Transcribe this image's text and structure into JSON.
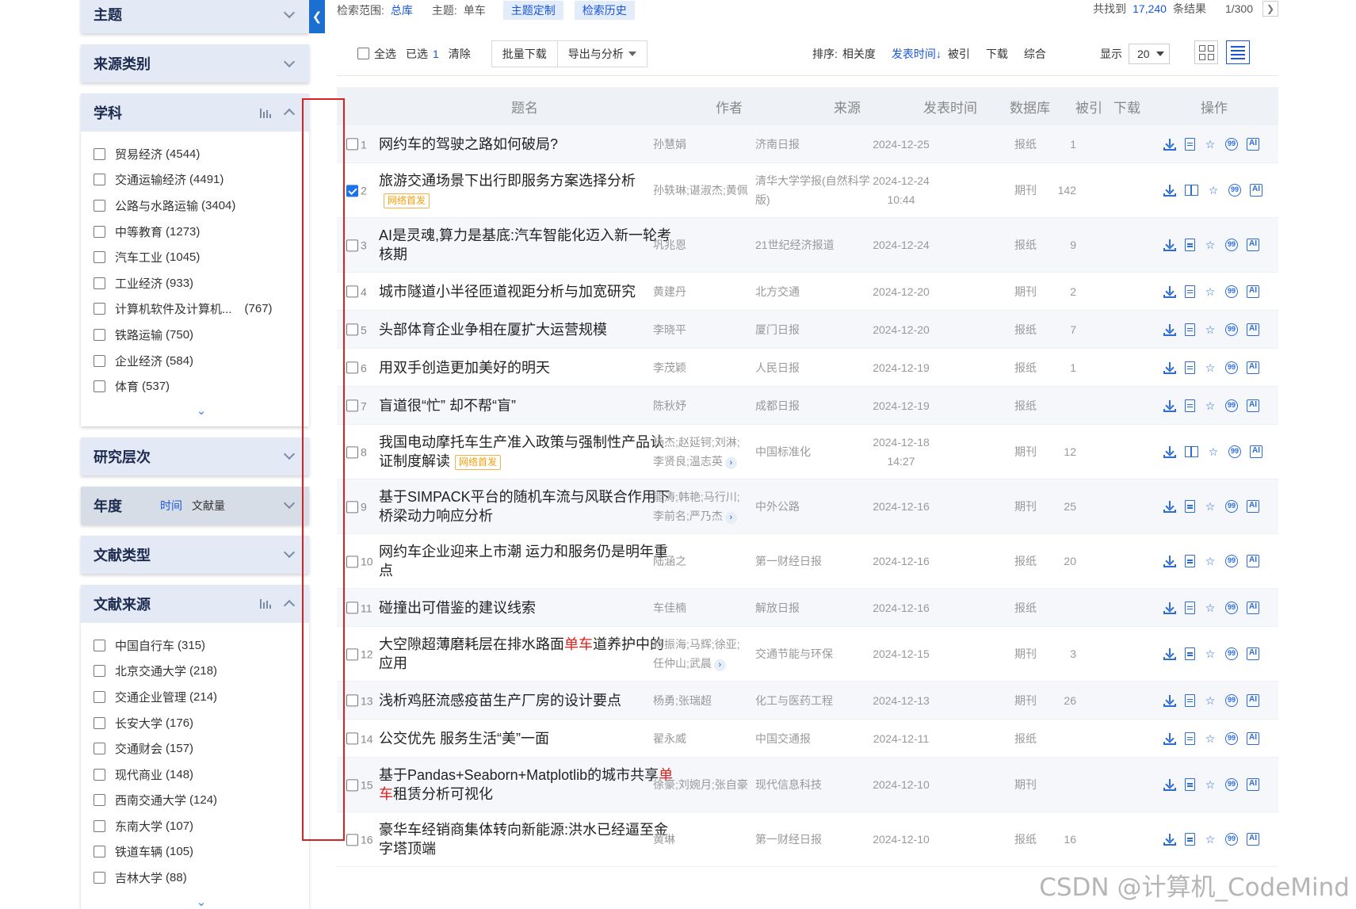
{
  "sidebar": {
    "panels": [
      {
        "title": "主题",
        "kind": "collapsed"
      },
      {
        "title": "来源类别",
        "kind": "collapsed"
      },
      {
        "title": "学科",
        "kind": "expanded",
        "items": [
          {
            "label": "贸易经济",
            "count": "(4544)"
          },
          {
            "label": "交通运输经济",
            "count": "(4491)"
          },
          {
            "label": "公路与水路运输",
            "count": "(3404)"
          },
          {
            "label": "中等教育",
            "count": "(1273)"
          },
          {
            "label": "汽车工业",
            "count": "(1045)"
          },
          {
            "label": "工业经济",
            "count": "(933)"
          },
          {
            "label": "计算机软件及计算机...",
            "count": "(767)"
          },
          {
            "label": "铁路运输",
            "count": "(750)"
          },
          {
            "label": "企业经济",
            "count": "(584)"
          },
          {
            "label": "体育",
            "count": "(537)"
          }
        ]
      },
      {
        "title": "研究层次",
        "kind": "collapsed"
      },
      {
        "title": "年度",
        "kind": "sort",
        "sort_time": "时间",
        "sort_count": "文献量"
      },
      {
        "title": "文献类型",
        "kind": "collapsed"
      },
      {
        "title": "文献来源",
        "kind": "expanded",
        "items": [
          {
            "label": "中国自行车",
            "count": "(315)"
          },
          {
            "label": "北京交通大学",
            "count": "(218)"
          },
          {
            "label": "交通企业管理",
            "count": "(214)"
          },
          {
            "label": "长安大学",
            "count": "(176)"
          },
          {
            "label": "交通财会",
            "count": "(157)"
          },
          {
            "label": "现代商业",
            "count": "(148)"
          },
          {
            "label": "西南交通大学",
            "count": "(124)"
          },
          {
            "label": "东南大学",
            "count": "(107)"
          },
          {
            "label": "铁道车辆",
            "count": "(105)"
          },
          {
            "label": "吉林大学",
            "count": "(88)"
          }
        ]
      }
    ]
  },
  "topline": {
    "scope_label": "检索范围:",
    "scope_value": "总库",
    "topic_label": "主题:",
    "topic_value": "单车",
    "custom_tag": "主题定制",
    "history_tag": "检索历史",
    "found_prefix": "共找到",
    "found_count": "17,240",
    "found_suffix": "条结果",
    "page": "1/300"
  },
  "toolbar": {
    "select_all": "全选",
    "selected_label": "已选",
    "selected_count": "1",
    "clear": "清除",
    "batch_download": "批量下载",
    "export": "导出与分析",
    "sort_label": "排序:",
    "sort_relevance": "相关度",
    "sort_date": "发表时间↓",
    "sort_cited": "被引",
    "sort_download": "下载",
    "sort_overall": "综合",
    "display_label": "显示",
    "display_value": "20"
  },
  "table": {
    "headers": {
      "title": "题名",
      "author": "作者",
      "source": "来源",
      "date": "发表时间",
      "db": "数据库",
      "cited": "被引",
      "downloads": "下载",
      "ops": "操作"
    },
    "rows": [
      {
        "n": "1",
        "checked": false,
        "title": "网约车的驾驶之路如何破局?",
        "hl": "",
        "title_after": "",
        "badge": "",
        "author": "孙慧娟",
        "author_more": false,
        "source": "济南日报",
        "date": "2024-12-25",
        "db": "报纸",
        "cited": "1",
        "book": false
      },
      {
        "n": "2",
        "checked": true,
        "title": "旅游交通场景下出行即服务方案选择分析",
        "hl": "",
        "title_after": "",
        "badge": "网络首发",
        "author": "孙轶琳;谌淑杰;黄佩",
        "author_more": false,
        "source": "清华大学学报(自然科学版)",
        "date": "2024-12-24 10:44",
        "db": "期刊",
        "cited": "142",
        "book": true
      },
      {
        "n": "3",
        "checked": false,
        "title": "AI是灵魂,算力是基底:汽车智能化迈入新一轮考核期",
        "hl": "",
        "title_after": "",
        "badge": "",
        "author": "巩兆恩",
        "author_more": false,
        "source": "21世纪经济报道",
        "date": "2024-12-24",
        "db": "报纸",
        "cited": "9",
        "book": false
      },
      {
        "n": "4",
        "checked": false,
        "title": "城市隧道小半径匝道视距分析与加宽研究",
        "hl": "",
        "title_after": "",
        "badge": "",
        "author": "黄建丹",
        "author_more": false,
        "source": "北方交通",
        "date": "2024-12-20",
        "db": "期刊",
        "cited": "2",
        "book": false
      },
      {
        "n": "5",
        "checked": false,
        "title": "头部体育企业争相在厦扩大运营规模",
        "hl": "",
        "title_after": "",
        "badge": "",
        "author": "李晓平",
        "author_more": false,
        "source": "厦门日报",
        "date": "2024-12-20",
        "db": "报纸",
        "cited": "7",
        "book": false
      },
      {
        "n": "6",
        "checked": false,
        "title": "用双手创造更加美好的明天",
        "hl": "",
        "title_after": "",
        "badge": "",
        "author": "李茂颖",
        "author_more": false,
        "source": "人民日报",
        "date": "2024-12-19",
        "db": "报纸",
        "cited": "1",
        "book": false
      },
      {
        "n": "7",
        "checked": false,
        "title": "盲道很“忙” 却不帮“盲”",
        "hl": "",
        "title_after": "",
        "badge": "",
        "author": "陈秋妤",
        "author_more": false,
        "source": "成都日报",
        "date": "2024-12-19",
        "db": "报纸",
        "cited": "",
        "book": false
      },
      {
        "n": "8",
        "checked": false,
        "title": "我国电动摩托车生产准入政策与强制性产品认证制度解读",
        "hl": "",
        "title_after": "",
        "badge": "网络首发",
        "author": "杨杰;赵延钶;刘淋;李贤良;温志英",
        "author_more": true,
        "source": "中国标准化",
        "date": "2024-12-18 14:27",
        "db": "期刊",
        "cited": "12",
        "book": true
      },
      {
        "n": "9",
        "checked": false,
        "title": "基于SIMPACK平台的随机车流与风联合作用下桥梁动力响应分析",
        "hl": "",
        "title_after": "",
        "badge": "",
        "author": "能涛;韩艳;马行川;李前名;严乃杰",
        "author_more": true,
        "source": "中外公路",
        "date": "2024-12-16",
        "db": "期刊",
        "cited": "25",
        "book": false
      },
      {
        "n": "10",
        "checked": false,
        "title": "网约车企业迎来上市潮 运力和服务仍是明年重点",
        "hl": "",
        "title_after": "",
        "badge": "",
        "author": "陆涵之",
        "author_more": false,
        "source": "第一财经日报",
        "date": "2024-12-16",
        "db": "报纸",
        "cited": "20",
        "book": false
      },
      {
        "n": "11",
        "checked": false,
        "title": "碰撞出可借鉴的建议线索",
        "hl": "",
        "title_after": "",
        "badge": "",
        "author": "车佳楠",
        "author_more": false,
        "source": "解放日报",
        "date": "2024-12-16",
        "db": "报纸",
        "cited": "",
        "book": false
      },
      {
        "n": "12",
        "checked": false,
        "title": "大空隙超薄磨耗层在排水路面",
        "hl": "单车",
        "title_after": "道养护中的应用",
        "badge": "",
        "author": "杨振海;马辉;徐亚;任仲山;武晨",
        "author_more": true,
        "source": "交通节能与环保",
        "date": "2024-12-15",
        "db": "期刊",
        "cited": "3",
        "book": false
      },
      {
        "n": "13",
        "checked": false,
        "title": "浅析鸡胚流感疫苗生产厂房的设计要点",
        "hl": "",
        "title_after": "",
        "badge": "",
        "author": "杨勇;张瑞超",
        "author_more": false,
        "source": "化工与医药工程",
        "date": "2024-12-13",
        "db": "期刊",
        "cited": "26",
        "book": false
      },
      {
        "n": "14",
        "checked": false,
        "title": "公交优先 服务生活“美”一面",
        "hl": "",
        "title_after": "",
        "badge": "",
        "author": "翟永威",
        "author_more": false,
        "source": "中国交通报",
        "date": "2024-12-11",
        "db": "报纸",
        "cited": "",
        "book": false
      },
      {
        "n": "15",
        "checked": false,
        "title": "基于Pandas+Seaborn+Matplotlib的城市共享",
        "hl": "单车",
        "title_after": "租赁分析可视化",
        "badge": "",
        "author": "徐豪;刘婉月;张自豪",
        "author_more": false,
        "source": "现代信息科技",
        "date": "2024-12-10",
        "db": "期刊",
        "cited": "",
        "book": false
      },
      {
        "n": "16",
        "checked": false,
        "title": "豪华车经销商集体转向新能源:洪水已经逼至金字塔顶端",
        "hl": "",
        "title_after": "",
        "badge": "",
        "author": "黄琳",
        "author_more": false,
        "source": "第一财经日报",
        "date": "2024-12-10",
        "db": "报纸",
        "cited": "16",
        "book": false
      }
    ]
  },
  "watermark": "CSDN @计算机_CodeMind",
  "icons": {
    "collapse": "chevron-left-icon",
    "download": "download-icon",
    "read": "read-html-icon",
    "book": "book-icon",
    "favorite": "star-icon",
    "cite": "quote-icon",
    "ai": "ai-icon"
  },
  "colors": {
    "accent": "#1a56db",
    "highlight": "#e0201b",
    "badge": "#f59e0b",
    "box": "#e02020"
  }
}
